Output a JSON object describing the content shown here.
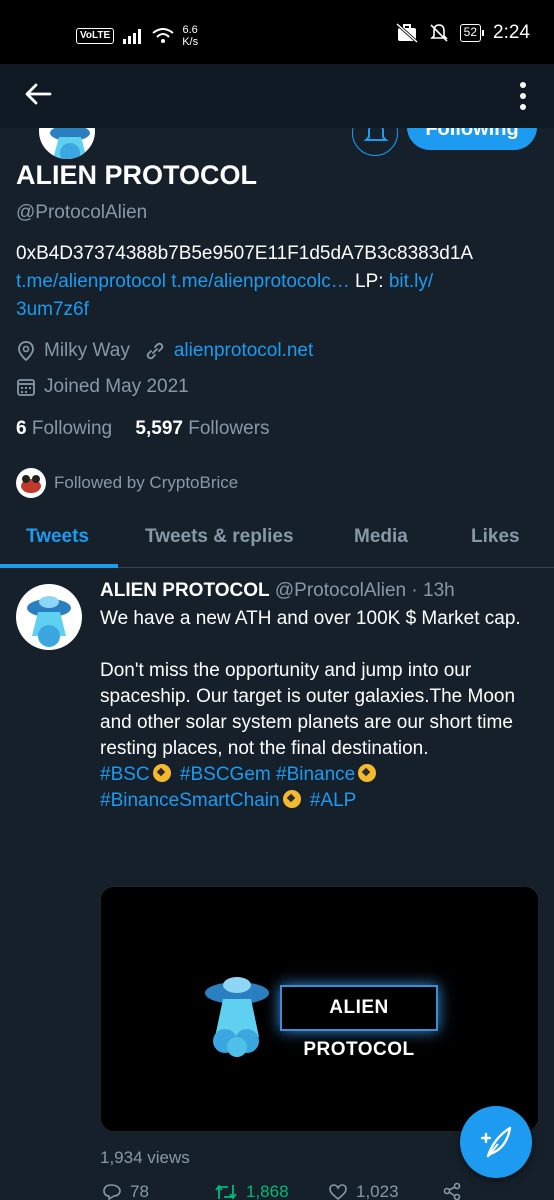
{
  "status_bar": {
    "volte": "VoLTE",
    "speed_value": "6.6",
    "speed_unit": "K/s",
    "battery": "52",
    "time": "2:24"
  },
  "profile": {
    "name": "ALIEN PROTOCOL",
    "handle": "@ProtocolAlien",
    "following_button": "Following",
    "bio_line1": "0xB4D37374388b7B5e9507E11F1d5dA7B3c8383d1A",
    "bio_link1": "t.me/alienprotocol",
    "bio_link2": "t.me/alienprotocolc…",
    "bio_lp": "LP:",
    "bio_link3": "bit.ly/",
    "bio_link3b": "3um7z6f",
    "location": "Milky Way",
    "website": "alienprotocol.net",
    "joined": "Joined May 2021",
    "following_count": "6",
    "following_label": "Following",
    "followers_count": "5,597",
    "followers_label": "Followers",
    "followed_by": "Followed by CryptoBrice"
  },
  "tabs": [
    "Tweets",
    "Tweets & replies",
    "Media",
    "Likes"
  ],
  "tweet": {
    "name": "ALIEN PROTOCOL",
    "handle_time": "@ProtocolAlien · 13h",
    "text_p1": "We have a new ATH and over 100K $ Market cap.",
    "text_p2": "Don't miss the opportunity and jump into our spaceship. Our target is outer galaxies.The Moon and other solar system planets are our short time resting places, not the final destination.",
    "hashtags": [
      "#BSC",
      "#BSCGem",
      "#Binance",
      "#BinanceSmartChain",
      "#ALP"
    ],
    "media_text": "ALIEN PROTOCOL",
    "views": "1,934 views",
    "replies": "78",
    "retweets": "1,868",
    "likes": "1,023"
  },
  "colors": {
    "background": "#15202b",
    "accent": "#1d9bf0",
    "secondary_text": "#8899a6",
    "retweet_green": "#00ba7c"
  }
}
